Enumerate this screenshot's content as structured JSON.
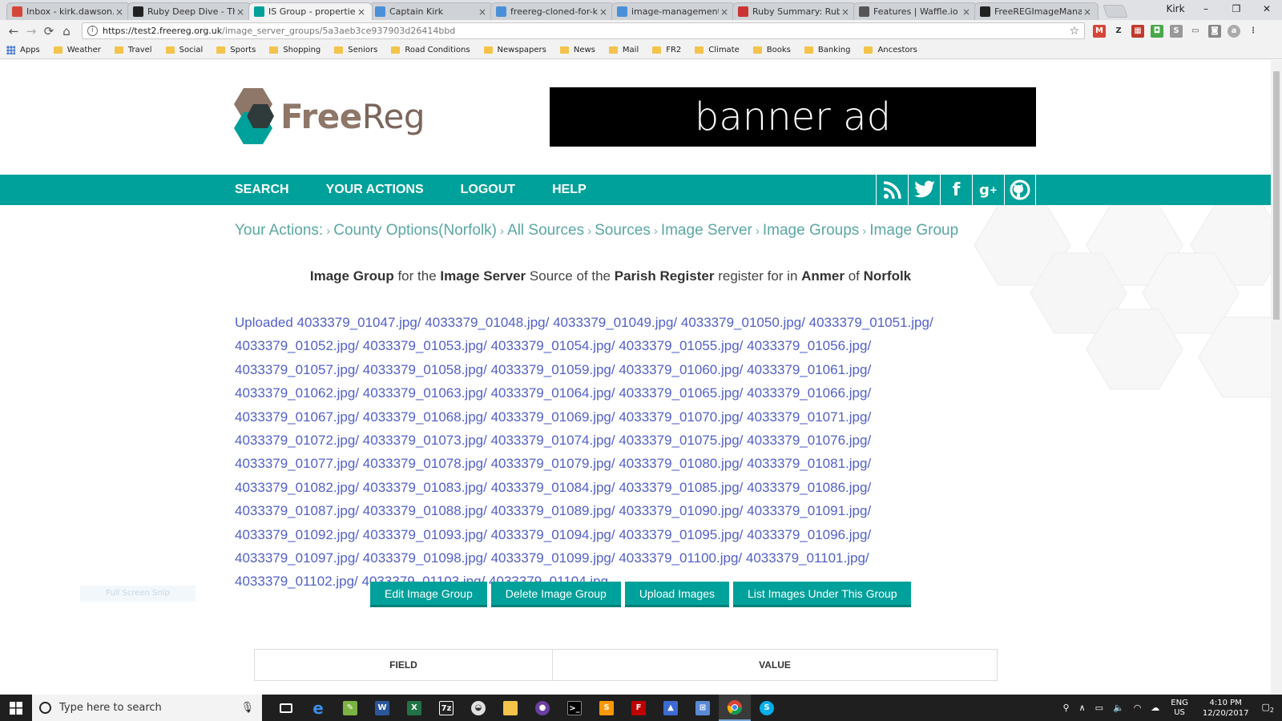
{
  "tabs": [
    {
      "label": "Inbox - kirk.dawson.bc",
      "color": "#d44638",
      "active": false
    },
    {
      "label": "Ruby Deep Dive - The I",
      "color": "#222222",
      "active": false
    },
    {
      "label": "IS Group - properties | I",
      "color": "#00a19a",
      "active": true
    },
    {
      "label": "Captain Kirk",
      "color": "#4a90d9",
      "active": false
    },
    {
      "label": "freereg-cloned-for-kirk",
      "color": "#4a90d9",
      "active": false
    },
    {
      "label": "image-management - C",
      "color": "#4a90d9",
      "active": false
    },
    {
      "label": "Ruby Summary: Ruby S",
      "color": "#cc3333",
      "active": false
    },
    {
      "label": "Features | Waffle.io",
      "color": "#555555",
      "active": false
    },
    {
      "label": "FreeREGImageManage",
      "color": "#222222",
      "active": false
    }
  ],
  "window": {
    "user_label": "Kirk",
    "minimize": "–",
    "restore": "❐",
    "close": "✕"
  },
  "address": {
    "host": "https://test2.freereg.org.uk",
    "path": "/image_server_groups/5a3aeb3ce937903d26414bbd"
  },
  "bookmarks": [
    "Apps",
    "Weather",
    "Travel",
    "Social",
    "Sports",
    "Shopping",
    "Seniors",
    "Road Conditions",
    "Newspapers",
    "News",
    "Mail",
    "FR2",
    "Climate",
    "Books",
    "Banking",
    "Ancestors"
  ],
  "site": {
    "brand_bold": "Free",
    "brand_light": "Reg",
    "banner": "banner ad",
    "nav": [
      "SEARCH",
      "YOUR ACTIONS",
      "LOGOUT",
      "HELP"
    ],
    "brand_color": "#00a19a"
  },
  "breadcrumb": [
    "Your Actions:",
    "County Options(Norfolk)",
    "All Sources",
    "Sources",
    "Image Server",
    "Image Groups",
    "Image Group"
  ],
  "heading": {
    "p1": "Image Group",
    "t1": " for the ",
    "p2": "Image Server",
    "t2": " Source of the ",
    "p3": "Parish Register",
    "t3": " register for in ",
    "p4": "Anmer",
    "t4": " of ",
    "p5": "Norfolk"
  },
  "uploaded_prefix": "Uploaded",
  "files": [
    "4033379_01047.jpg/",
    "4033379_01048.jpg/",
    "4033379_01049.jpg/",
    "4033379_01050.jpg/",
    "4033379_01051.jpg/",
    "4033379_01052.jpg/",
    "4033379_01053.jpg/",
    "4033379_01054.jpg/",
    "4033379_01055.jpg/",
    "4033379_01056.jpg/",
    "4033379_01057.jpg/",
    "4033379_01058.jpg/",
    "4033379_01059.jpg/",
    "4033379_01060.jpg/",
    "4033379_01061.jpg/",
    "4033379_01062.jpg/",
    "4033379_01063.jpg/",
    "4033379_01064.jpg/",
    "4033379_01065.jpg/",
    "4033379_01066.jpg/",
    "4033379_01067.jpg/",
    "4033379_01068.jpg/",
    "4033379_01069.jpg/",
    "4033379_01070.jpg/",
    "4033379_01071.jpg/",
    "4033379_01072.jpg/",
    "4033379_01073.jpg/",
    "4033379_01074.jpg/",
    "4033379_01075.jpg/",
    "4033379_01076.jpg/",
    "4033379_01077.jpg/",
    "4033379_01078.jpg/",
    "4033379_01079.jpg/",
    "4033379_01080.jpg/",
    "4033379_01081.jpg/",
    "4033379_01082.jpg/",
    "4033379_01083.jpg/",
    "4033379_01084.jpg/",
    "4033379_01085.jpg/",
    "4033379_01086.jpg/",
    "4033379_01087.jpg/",
    "4033379_01088.jpg/",
    "4033379_01089.jpg/",
    "4033379_01090.jpg/",
    "4033379_01091.jpg/",
    "4033379_01092.jpg/",
    "4033379_01093.jpg/",
    "4033379_01094.jpg/",
    "4033379_01095.jpg/",
    "4033379_01096.jpg/",
    "4033379_01097.jpg/",
    "4033379_01098.jpg/",
    "4033379_01099.jpg/",
    "4033379_01100.jpg/",
    "4033379_01101.jpg/",
    "4033379_01102.jpg/",
    "4033379_01103.jpg/",
    "4033379_01104.jpg"
  ],
  "buttons": {
    "edit": "Edit Image Group",
    "delete": "Delete Image Group",
    "upload": "Upload Images",
    "list": "List Images Under This Group"
  },
  "ghost_label": "Full Screen Snip",
  "table": {
    "field": "FIELD",
    "value": "VALUE"
  },
  "taskbar": {
    "search_placeholder": "Type here to search",
    "lang": "ENG",
    "region": "US",
    "time": "4:10 PM",
    "date": "12/20/2017",
    "notif_count": "2"
  }
}
